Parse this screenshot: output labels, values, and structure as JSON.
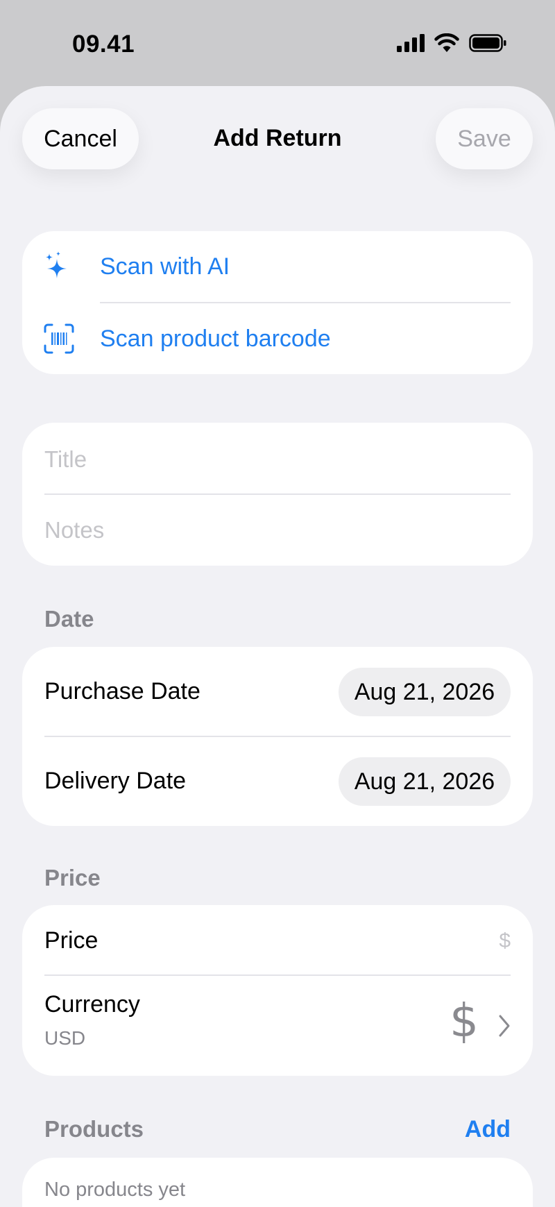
{
  "status_bar": {
    "time": "09.41"
  },
  "nav": {
    "title": "Add Return",
    "cancel_label": "Cancel",
    "save_label": "Save"
  },
  "scan": {
    "ai_label": "Scan with AI",
    "barcode_label": "Scan product barcode"
  },
  "details": {
    "title_placeholder": "Title",
    "notes_placeholder": "Notes"
  },
  "date_section": {
    "header": "Date",
    "purchase_label": "Purchase Date",
    "purchase_value": "Aug 21, 2026",
    "delivery_label": "Delivery Date",
    "delivery_value": "Aug 21, 2026"
  },
  "price_section": {
    "header": "Price",
    "price_label": "Price",
    "price_placeholder": "$",
    "currency_label": "Currency",
    "currency_code": "USD",
    "currency_symbol": "$"
  },
  "products_section": {
    "header": "Products",
    "add_label": "Add",
    "empty_text": "No products yet"
  },
  "colors": {
    "accent": "#1f7ff0",
    "background": "#f1f1f5",
    "card": "#ffffff"
  }
}
